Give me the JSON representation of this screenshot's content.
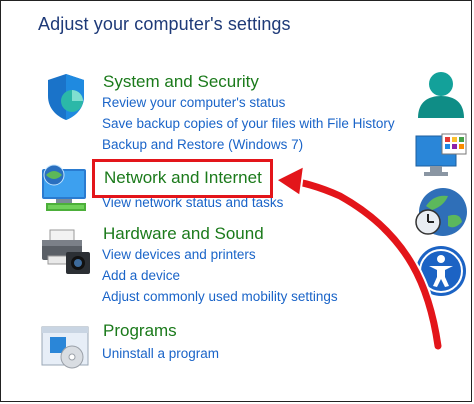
{
  "page": {
    "title": "Adjust your computer's settings"
  },
  "categories": [
    {
      "title": "System and Security",
      "icon": "shield-icon",
      "links": [
        "Review your computer's status",
        "Save backup copies of your files with File History",
        "Backup and Restore (Windows 7)"
      ]
    },
    {
      "title": "Network and Internet",
      "icon": "network-globe-icon",
      "links": [
        "View network status and tasks"
      ]
    },
    {
      "title": "Hardware and Sound",
      "icon": "printer-icon",
      "links": [
        "View devices and printers",
        "Add a device",
        "Adjust commonly used mobility settings"
      ]
    },
    {
      "title": "Programs",
      "icon": "programs-icon",
      "links": [
        "Uninstall a program"
      ]
    }
  ],
  "right_icons": [
    "user-accounts-icon",
    "appearance-icon",
    "clock-region-icon",
    "ease-of-access-icon"
  ],
  "colors": {
    "title": "#1e3a78",
    "category_title": "#1b7a1b",
    "link": "#1a64c8",
    "highlight": "#e3151a",
    "arrow": "#e3151a"
  }
}
